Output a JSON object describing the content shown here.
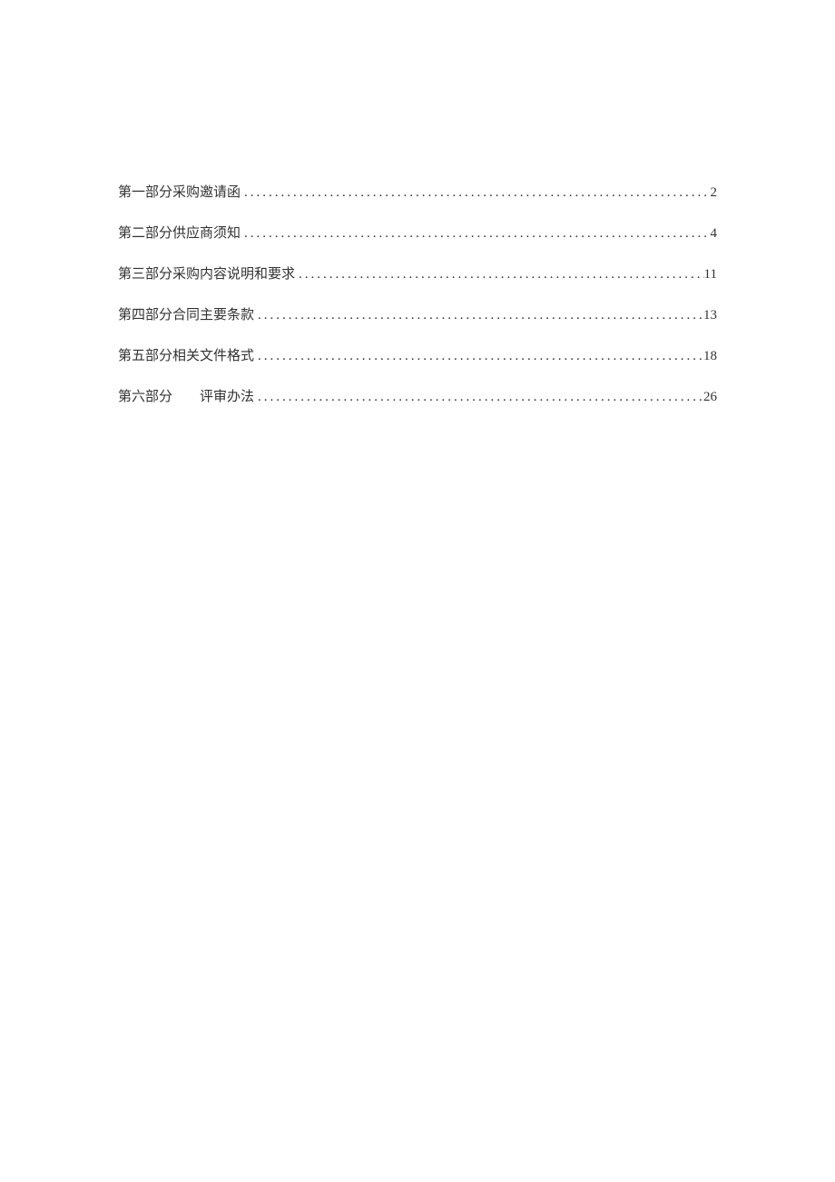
{
  "toc": {
    "entries": [
      {
        "title": "第一部分采购邀请函",
        "page": "2"
      },
      {
        "title": "第二部分供应商须知",
        "page": "4"
      },
      {
        "title": "第三部分采购内容说明和要求",
        "page": "11"
      },
      {
        "title": "第四部分合同主要条款",
        "page": "13"
      },
      {
        "title": "第五部分相关文件格式",
        "page": "18"
      },
      {
        "title_prefix": "第六部分",
        "title_suffix": "评审办法",
        "page": "26",
        "has_gap": true
      }
    ]
  }
}
